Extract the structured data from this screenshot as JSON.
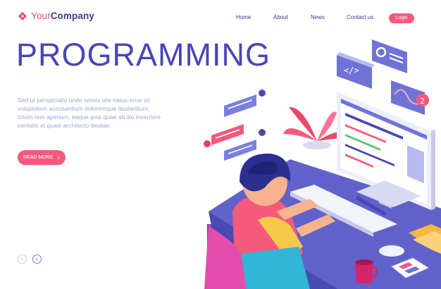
{
  "header": {
    "logo_part1": "Your",
    "logo_part2": "Company",
    "nav": [
      "Home",
      "About",
      "News",
      "Contact us"
    ],
    "login": "Login"
  },
  "hero": {
    "title": "PROGRAMMING",
    "description": "Sed ut perspiciatis unde omnis iste natus error sit voluptatem accusantium doloremque laudantium, totam rem aperiam, eaque ipsa quae ab illo inventore veritatis et quasi architecto beatae.",
    "read_more": "READ MORE"
  },
  "carousel": {
    "prev": "‹",
    "next": "›"
  },
  "illustration": {
    "code_icon": "</>",
    "notification_count": "2"
  },
  "colors": {
    "brand_pink": "#f55a7d",
    "brand_indigo": "#4846b4",
    "desk": "#6162c9"
  }
}
